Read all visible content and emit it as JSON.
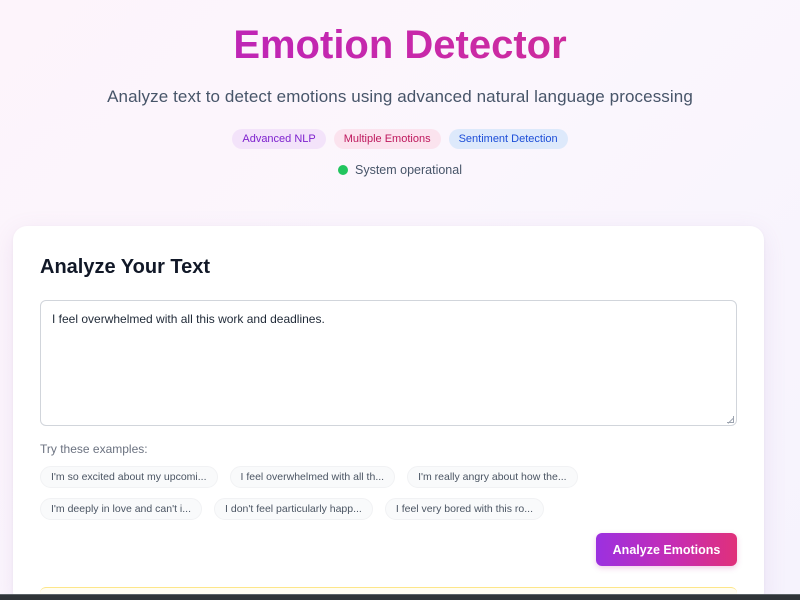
{
  "header": {
    "title": "Emotion Detector",
    "subtitle": "Analyze text to detect emotions using advanced natural language processing",
    "badges": [
      "Advanced NLP",
      "Multiple Emotions",
      "Sentiment Detection"
    ],
    "status": "System operational"
  },
  "analyze": {
    "title": "Analyze Your Text",
    "input_value": "I feel overwhelmed with all this work and deadlines.",
    "examples_label": "Try these examples:",
    "examples": [
      "I'm so excited about my upcomi...",
      "I feel overwhelmed with all th...",
      "I'm really angry about how the...",
      "I'm deeply in love and can't i...",
      "I don't feel particularly happ...",
      "I feel very bored with this ro..."
    ],
    "button_label": "Analyze Emotions"
  },
  "colors": {
    "brand_gradient_start": "#9b30e0",
    "brand_gradient_end": "#e0307a",
    "status_ok": "#22c55e"
  }
}
